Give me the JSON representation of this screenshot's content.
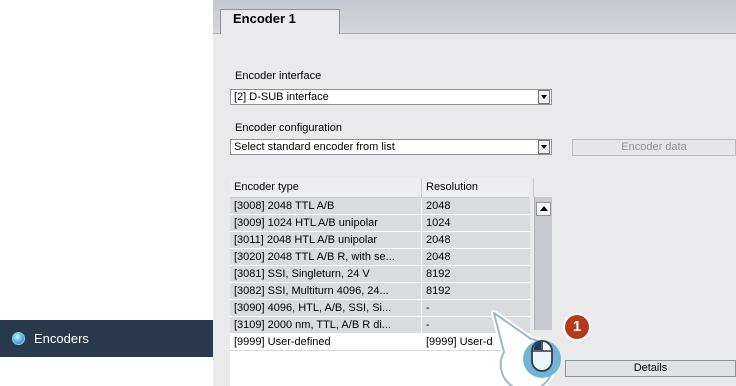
{
  "nav": {
    "encoders_label": "Encoders"
  },
  "tabs": [
    {
      "label": "Encoder 1"
    }
  ],
  "encoder_interface": {
    "label": "Encoder interface",
    "value": "[2] D-SUB interface"
  },
  "encoder_configuration": {
    "label": "Encoder configuration",
    "value": "Select standard encoder from list"
  },
  "buttons": {
    "encoder_data": "Encoder data",
    "details": "Details"
  },
  "table": {
    "headers": [
      "Encoder type",
      "Resolution"
    ],
    "rows": [
      [
        "[3008] 2048 TTL A/B",
        "2048"
      ],
      [
        "[3009] 1024 HTL A/B unipolar",
        "1024"
      ],
      [
        "[3011] 2048 HTL A/B unipolar",
        "2048"
      ],
      [
        "[3020] 2048 TTL A/B R, with se...",
        "2048"
      ],
      [
        "[3081] SSI, Singleturn, 24 V",
        "8192"
      ],
      [
        "[3082] SSI, Multiturn 4096, 24...",
        "8192"
      ],
      [
        "[3090] 4096, HTL, A/B, SSI, Si...",
        "-"
      ],
      [
        "[3109] 2000 nm, TTL, A/B R di...",
        "-"
      ],
      [
        "[9999] User-defined",
        "[9999] User-d"
      ]
    ]
  },
  "callout": {
    "step_number": "1",
    "icon": "mouse-click-icon"
  },
  "colors": {
    "nav_bg": "#2a3a4e",
    "badge": "#b33b1b",
    "panel_bg": "#eaeaed"
  }
}
